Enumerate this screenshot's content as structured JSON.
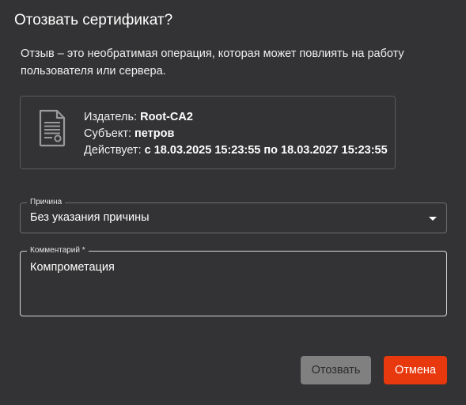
{
  "dialog": {
    "title": "Отозвать сертификат?",
    "description": "Отзыв – это необратимая операция, которая может повлиять на работу пользователя или сервера."
  },
  "certificate": {
    "icon": "certificate-document-icon",
    "issuer_label": "Издатель: ",
    "issuer_value": "Root-CA2",
    "subject_label": "Субъект: ",
    "subject_value": "петров",
    "valid_label": "Действует: ",
    "valid_value": "с 18.03.2025 15:23:55 по 18.03.2027 15:23:55"
  },
  "reason": {
    "label": "Причина",
    "value": "Без указания причины"
  },
  "comment": {
    "label": "Комментарий *",
    "value": "Компрометация"
  },
  "buttons": {
    "revoke_label": "Отозвать",
    "cancel_label": "Отмена"
  },
  "colors": {
    "background": "#333234",
    "accent": "#e8380d",
    "disabled_button": "#808080"
  }
}
